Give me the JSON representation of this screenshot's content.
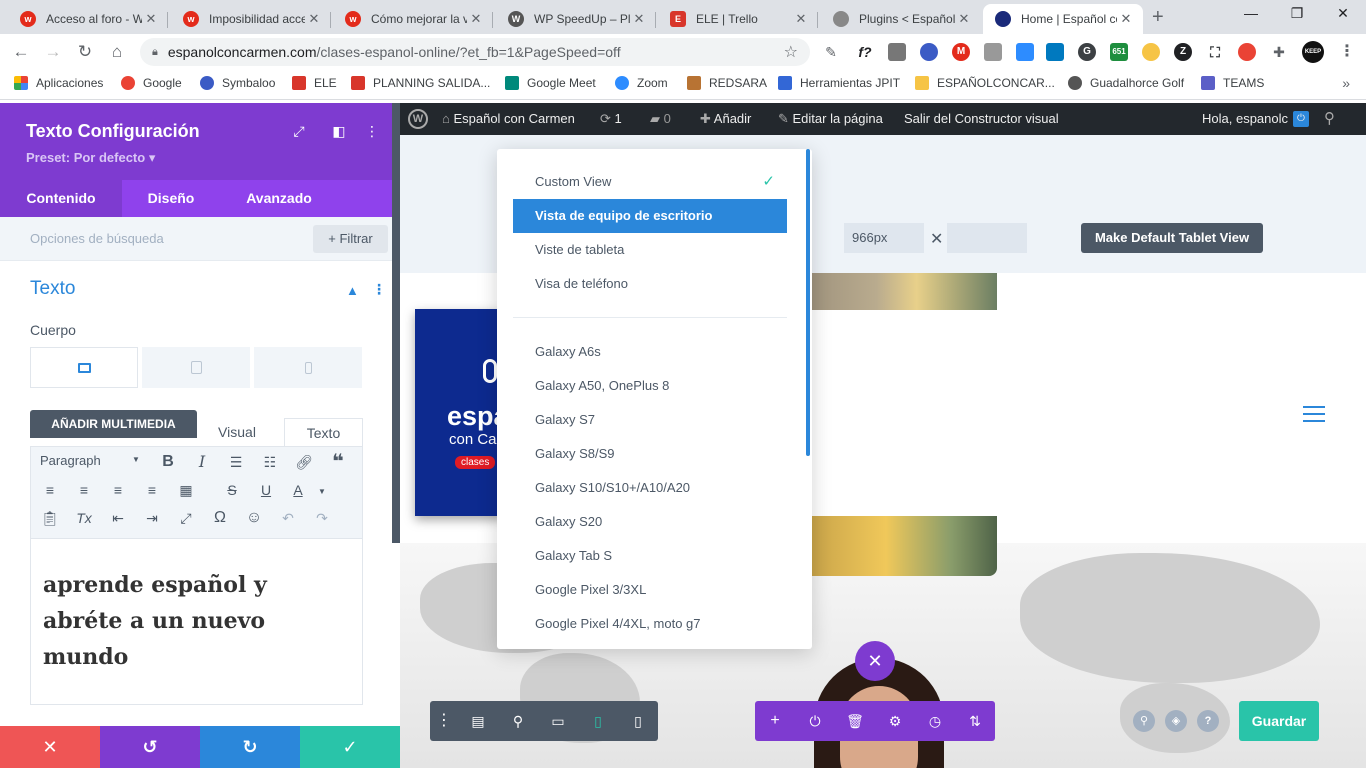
{
  "browser": {
    "tabs": [
      {
        "title": "Acceso al foro - W",
        "icon": "wordfence-icon",
        "color": "#e32b1b",
        "glyph": "w"
      },
      {
        "title": "Imposibilidad acce",
        "icon": "wordfence-icon",
        "color": "#e32b1b",
        "glyph": "w"
      },
      {
        "title": "Cómo mejorar la v",
        "icon": "wordfence-icon",
        "color": "#e32b1b",
        "glyph": "w"
      },
      {
        "title": "WP SpeedUp – Plu",
        "icon": "wordpress-icon",
        "color": "#555555",
        "glyph": "W"
      },
      {
        "title": "ELE | Trello",
        "icon": "ele-icon",
        "color": "#d8362b",
        "glyph": "E"
      },
      {
        "title": "Plugins < Español",
        "icon": "globe-icon",
        "color": "#666666",
        "glyph": "○"
      },
      {
        "title": "Home | Español co",
        "icon": "mic-icon",
        "color": "#1a2a7a",
        "glyph": "●"
      }
    ],
    "url_host": "espanolconcarmen.com",
    "url_path": "/clases-espanol-online/?et_fb=1&PageSpeed=off",
    "bookmarks": [
      {
        "label": "Aplicaciones",
        "color": "#4285f4"
      },
      {
        "label": "Google",
        "color": "#ea4335"
      },
      {
        "label": "Symbaloo",
        "color": "#3b5bc5"
      },
      {
        "label": "ELE",
        "color": "#d8362b"
      },
      {
        "label": "PLANNING SALIDA...",
        "color": "#d8362b"
      },
      {
        "label": "Google Meet",
        "color": "#00897b"
      },
      {
        "label": "Zoom",
        "color": "#2d8cff"
      },
      {
        "label": "REDSARA",
        "color": "#b87333"
      },
      {
        "label": "Herramientas JPIT",
        "color": "#3367d6"
      },
      {
        "label": "ESPAÑOLCONCAR...",
        "color": "#f6c445"
      },
      {
        "label": "Guadalhorce Golf",
        "color": "#555555"
      },
      {
        "label": "TEAMS",
        "color": "#5b5fc7"
      }
    ]
  },
  "panel": {
    "title": "Texto Configuración",
    "preset": "Preset: Por defecto ▾",
    "tabs": [
      "Contenido",
      "Diseño",
      "Avanzado"
    ],
    "search_placeholder": "Opciones de búsqueda",
    "filter_label": "+ Filtrar",
    "section_title": "Texto",
    "field_label": "Cuerpo",
    "add_media": "AÑADIR MULTIMEDIA",
    "editor_tabs": [
      "Visual",
      "Texto"
    ],
    "format_select": "Paragraph",
    "content": "aprende español y abréte a un nuevo mundo"
  },
  "wpbar": {
    "site_name": "Español con Carmen",
    "updates": "1",
    "comments": "0",
    "add_new": "Añadir",
    "edit_page": "Editar la página",
    "exit_builder": "Salir del Constructor visual",
    "greeting": "Hola, espanolc"
  },
  "viewbar": {
    "width_value": "966px",
    "height_value": "",
    "default_btn": "Make Default Tablet View"
  },
  "dropdown": {
    "custom_view": "Custom View",
    "items": [
      "Vista de equipo de escritorio",
      "Viste de tableta",
      "Visa de teléfono"
    ],
    "selected": "Vista de equipo de escritorio",
    "devices": [
      "Galaxy A6s",
      "Galaxy A50, OnePlus 8",
      "Galaxy S7",
      "Galaxy S8/S9",
      "Galaxy S10/S10+/A10/A20",
      "Galaxy S20",
      "Galaxy Tab S",
      "Google Pixel 3/3XL",
      "Google Pixel 4/4XL, moto g7"
    ]
  },
  "site": {
    "logo_line1": "espa",
    "logo_line2": "con Ca",
    "logo_badge": "clases"
  },
  "actions": {
    "save": "Guardar"
  },
  "colors": {
    "divi_purple": "#7e3bd0",
    "divi_blue": "#2b87da",
    "divi_green": "#29c4a9",
    "divi_red": "#ef5555"
  }
}
